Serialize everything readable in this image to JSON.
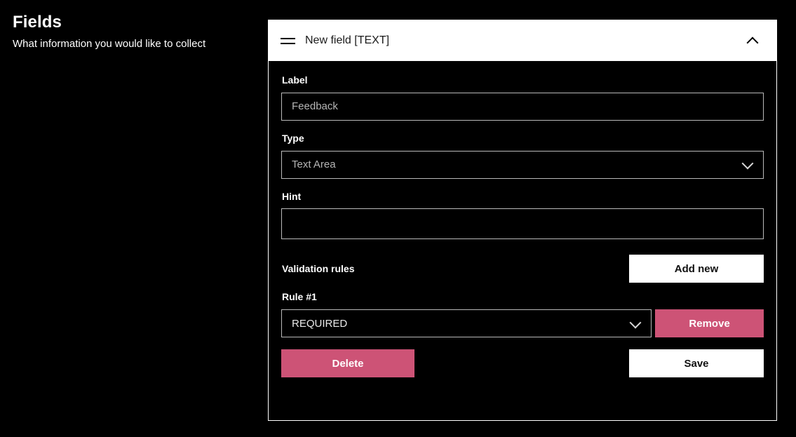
{
  "left_pane": {
    "title": "Fields",
    "subtitle": "What information you would like to collect"
  },
  "field_card": {
    "header": {
      "drag_handle_icon": "drag-handle-icon",
      "title": "New field [TEXT]",
      "collapse_icon": "chevron-up-icon"
    },
    "label_field": {
      "label": "Label",
      "value": "Feedback",
      "placeholder": "Feedback"
    },
    "type_field": {
      "label": "Type",
      "value": "Text Area",
      "dropdown_icon": "chevron-down-icon",
      "options": [
        "Text Area"
      ]
    },
    "hint_field": {
      "label": "Hint",
      "value": "",
      "placeholder": ""
    },
    "validation": {
      "section_label": "Validation rules",
      "add_new_label": "Add new",
      "rules": [
        {
          "label": "Rule #1",
          "value": "REQUIRED",
          "dropdown_icon": "chevron-down-icon",
          "options": [
            "REQUIRED"
          ],
          "remove_label": "Remove"
        }
      ]
    },
    "footer": {
      "delete_label": "Delete",
      "save_label": "Save"
    }
  },
  "colors": {
    "background": "#000000",
    "card_border": "#ffffff",
    "header_background": "#ffffff",
    "input_border": "#b9b9b9",
    "accent_pink": "#cd5376",
    "text_primary": "#ffffff",
    "placeholder_text": "#b5b5b5"
  }
}
